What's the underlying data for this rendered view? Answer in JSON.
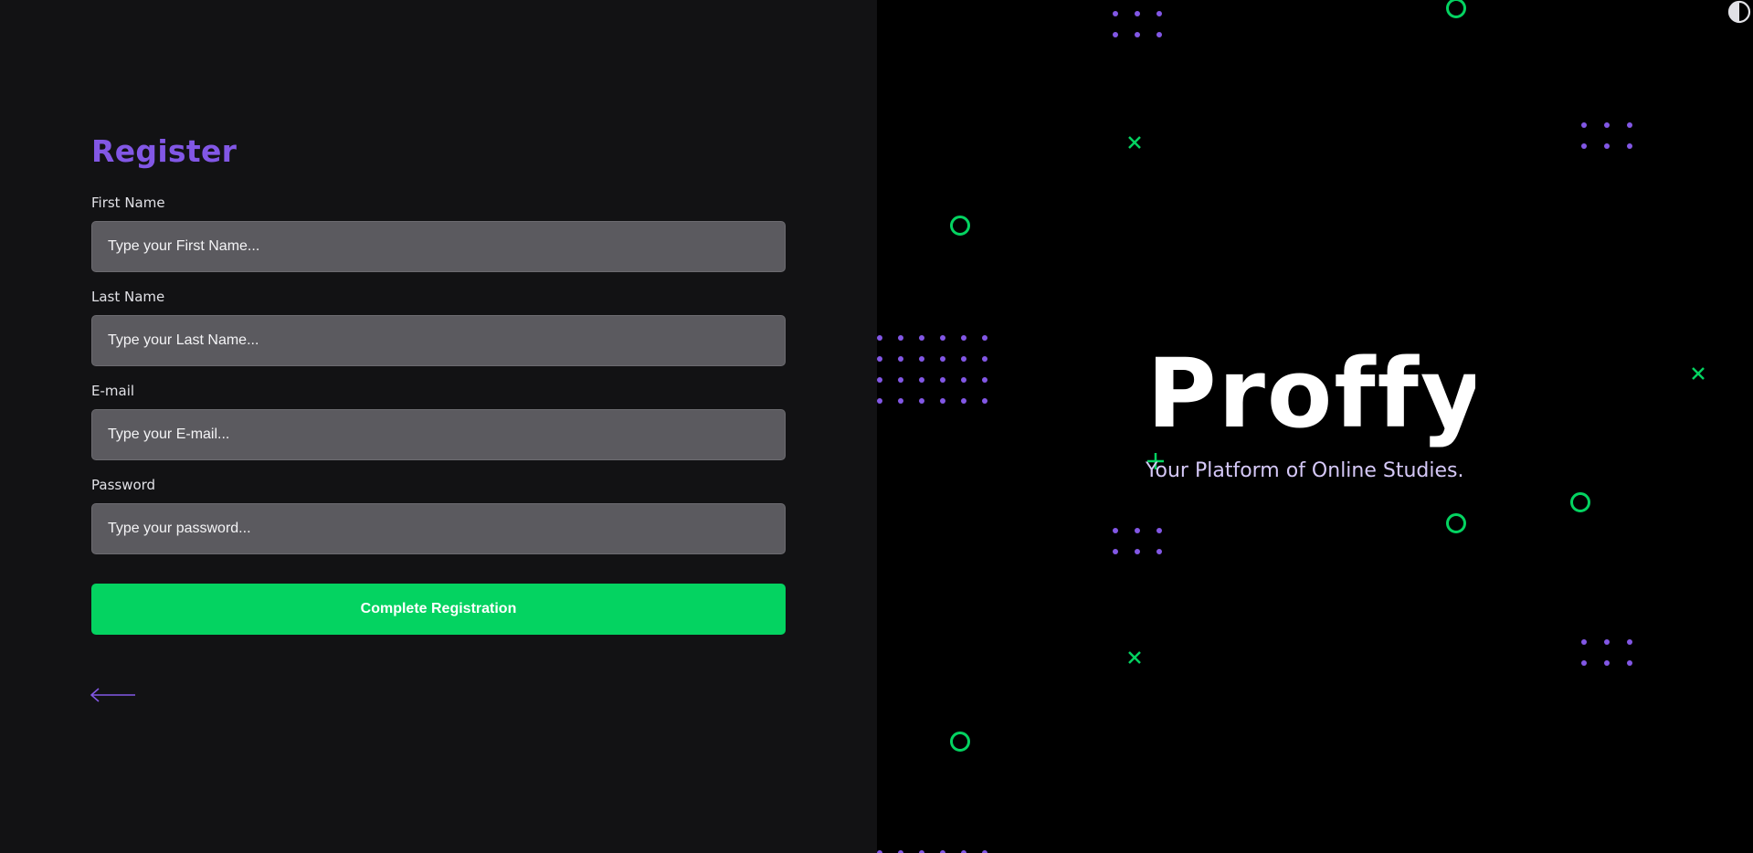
{
  "form": {
    "title": "Register",
    "fields": [
      {
        "label": "First Name",
        "placeholder": "Type your First Name...",
        "value": ""
      },
      {
        "label": "Last Name",
        "placeholder": "Type your Last Name...",
        "value": ""
      },
      {
        "label": "E-mail",
        "placeholder": "Type your E-mail...",
        "value": ""
      },
      {
        "label": "Password",
        "placeholder": "Type your password...",
        "value": ""
      }
    ],
    "submit_label": "Complete Registration",
    "back_icon": "arrow-left-icon"
  },
  "brand": {
    "logo_text": "Proffy",
    "tagline": "Your Platform of Online Studies.",
    "theme_toggle_icon": "half-circle-contrast-icon"
  },
  "colors": {
    "accent_purple": "#8257e5",
    "accent_green": "#04d361",
    "input_bg": "#5b5a5f",
    "left_bg": "#121214",
    "right_bg": "#000000",
    "tagline": "#d5c8f7"
  }
}
